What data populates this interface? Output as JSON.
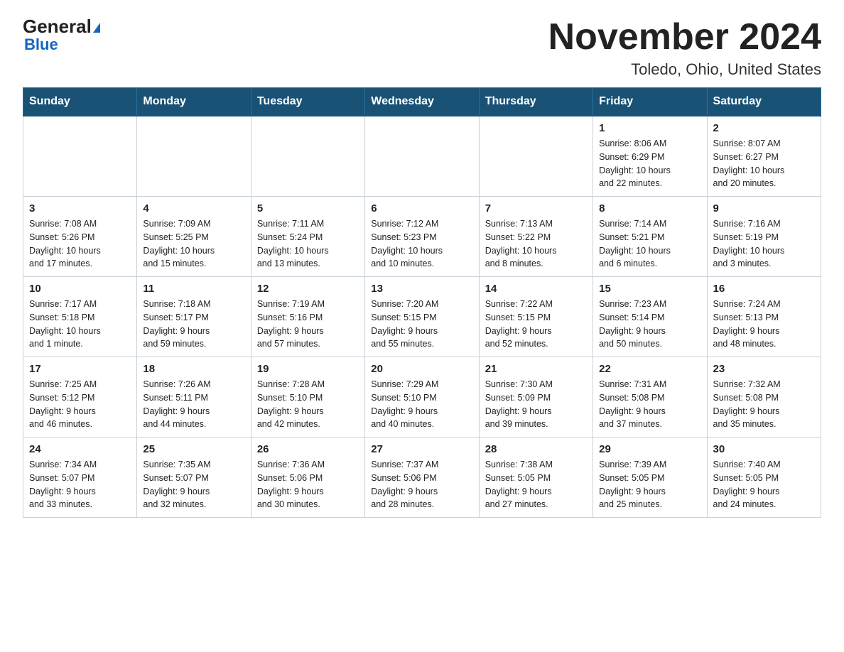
{
  "logo": {
    "general": "General",
    "blue": "Blue",
    "triangle_aria": "logo triangle"
  },
  "title": "November 2024",
  "location": "Toledo, Ohio, United States",
  "days_of_week": [
    "Sunday",
    "Monday",
    "Tuesday",
    "Wednesday",
    "Thursday",
    "Friday",
    "Saturday"
  ],
  "weeks": [
    [
      {
        "day": "",
        "info": ""
      },
      {
        "day": "",
        "info": ""
      },
      {
        "day": "",
        "info": ""
      },
      {
        "day": "",
        "info": ""
      },
      {
        "day": "",
        "info": ""
      },
      {
        "day": "1",
        "info": "Sunrise: 8:06 AM\nSunset: 6:29 PM\nDaylight: 10 hours\nand 22 minutes."
      },
      {
        "day": "2",
        "info": "Sunrise: 8:07 AM\nSunset: 6:27 PM\nDaylight: 10 hours\nand 20 minutes."
      }
    ],
    [
      {
        "day": "3",
        "info": "Sunrise: 7:08 AM\nSunset: 5:26 PM\nDaylight: 10 hours\nand 17 minutes."
      },
      {
        "day": "4",
        "info": "Sunrise: 7:09 AM\nSunset: 5:25 PM\nDaylight: 10 hours\nand 15 minutes."
      },
      {
        "day": "5",
        "info": "Sunrise: 7:11 AM\nSunset: 5:24 PM\nDaylight: 10 hours\nand 13 minutes."
      },
      {
        "day": "6",
        "info": "Sunrise: 7:12 AM\nSunset: 5:23 PM\nDaylight: 10 hours\nand 10 minutes."
      },
      {
        "day": "7",
        "info": "Sunrise: 7:13 AM\nSunset: 5:22 PM\nDaylight: 10 hours\nand 8 minutes."
      },
      {
        "day": "8",
        "info": "Sunrise: 7:14 AM\nSunset: 5:21 PM\nDaylight: 10 hours\nand 6 minutes."
      },
      {
        "day": "9",
        "info": "Sunrise: 7:16 AM\nSunset: 5:19 PM\nDaylight: 10 hours\nand 3 minutes."
      }
    ],
    [
      {
        "day": "10",
        "info": "Sunrise: 7:17 AM\nSunset: 5:18 PM\nDaylight: 10 hours\nand 1 minute."
      },
      {
        "day": "11",
        "info": "Sunrise: 7:18 AM\nSunset: 5:17 PM\nDaylight: 9 hours\nand 59 minutes."
      },
      {
        "day": "12",
        "info": "Sunrise: 7:19 AM\nSunset: 5:16 PM\nDaylight: 9 hours\nand 57 minutes."
      },
      {
        "day": "13",
        "info": "Sunrise: 7:20 AM\nSunset: 5:15 PM\nDaylight: 9 hours\nand 55 minutes."
      },
      {
        "day": "14",
        "info": "Sunrise: 7:22 AM\nSunset: 5:15 PM\nDaylight: 9 hours\nand 52 minutes."
      },
      {
        "day": "15",
        "info": "Sunrise: 7:23 AM\nSunset: 5:14 PM\nDaylight: 9 hours\nand 50 minutes."
      },
      {
        "day": "16",
        "info": "Sunrise: 7:24 AM\nSunset: 5:13 PM\nDaylight: 9 hours\nand 48 minutes."
      }
    ],
    [
      {
        "day": "17",
        "info": "Sunrise: 7:25 AM\nSunset: 5:12 PM\nDaylight: 9 hours\nand 46 minutes."
      },
      {
        "day": "18",
        "info": "Sunrise: 7:26 AM\nSunset: 5:11 PM\nDaylight: 9 hours\nand 44 minutes."
      },
      {
        "day": "19",
        "info": "Sunrise: 7:28 AM\nSunset: 5:10 PM\nDaylight: 9 hours\nand 42 minutes."
      },
      {
        "day": "20",
        "info": "Sunrise: 7:29 AM\nSunset: 5:10 PM\nDaylight: 9 hours\nand 40 minutes."
      },
      {
        "day": "21",
        "info": "Sunrise: 7:30 AM\nSunset: 5:09 PM\nDaylight: 9 hours\nand 39 minutes."
      },
      {
        "day": "22",
        "info": "Sunrise: 7:31 AM\nSunset: 5:08 PM\nDaylight: 9 hours\nand 37 minutes."
      },
      {
        "day": "23",
        "info": "Sunrise: 7:32 AM\nSunset: 5:08 PM\nDaylight: 9 hours\nand 35 minutes."
      }
    ],
    [
      {
        "day": "24",
        "info": "Sunrise: 7:34 AM\nSunset: 5:07 PM\nDaylight: 9 hours\nand 33 minutes."
      },
      {
        "day": "25",
        "info": "Sunrise: 7:35 AM\nSunset: 5:07 PM\nDaylight: 9 hours\nand 32 minutes."
      },
      {
        "day": "26",
        "info": "Sunrise: 7:36 AM\nSunset: 5:06 PM\nDaylight: 9 hours\nand 30 minutes."
      },
      {
        "day": "27",
        "info": "Sunrise: 7:37 AM\nSunset: 5:06 PM\nDaylight: 9 hours\nand 28 minutes."
      },
      {
        "day": "28",
        "info": "Sunrise: 7:38 AM\nSunset: 5:05 PM\nDaylight: 9 hours\nand 27 minutes."
      },
      {
        "day": "29",
        "info": "Sunrise: 7:39 AM\nSunset: 5:05 PM\nDaylight: 9 hours\nand 25 minutes."
      },
      {
        "day": "30",
        "info": "Sunrise: 7:40 AM\nSunset: 5:05 PM\nDaylight: 9 hours\nand 24 minutes."
      }
    ]
  ]
}
